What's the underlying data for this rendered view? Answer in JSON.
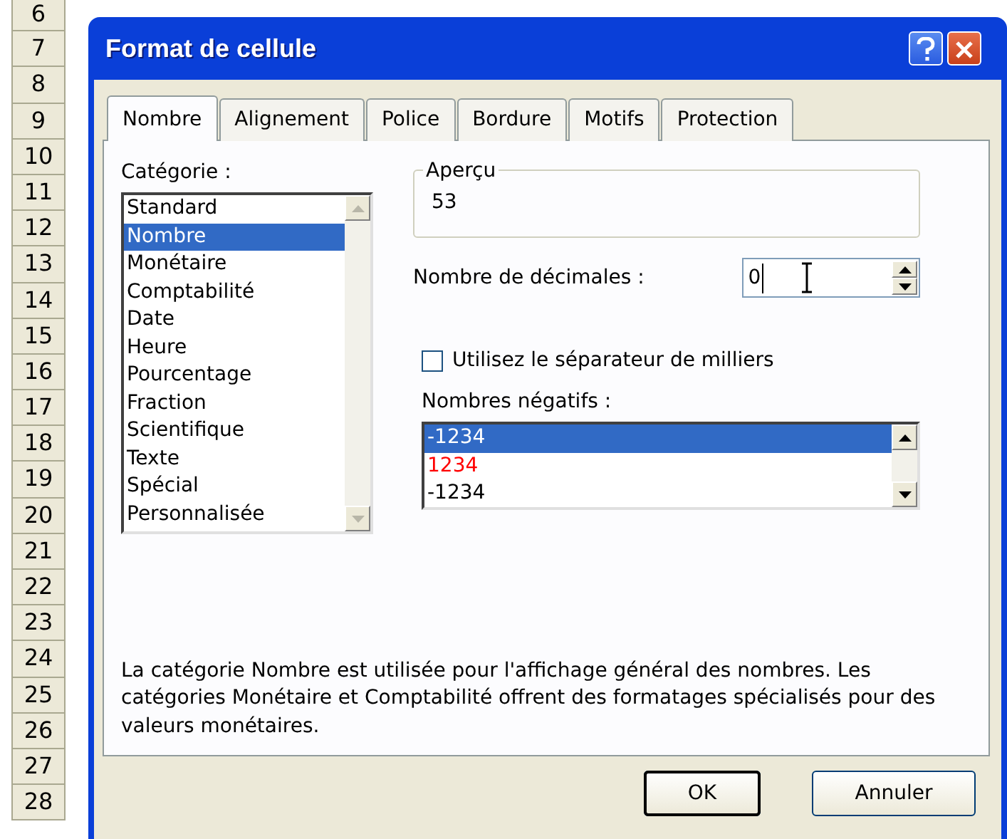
{
  "row_headers": [
    "6",
    "7",
    "8",
    "9",
    "10",
    "11",
    "12",
    "13",
    "14",
    "15",
    "16",
    "17",
    "18",
    "19",
    "20",
    "21",
    "22",
    "23",
    "24",
    "25",
    "26",
    "27",
    "28"
  ],
  "dialog": {
    "title": "Format de cellule",
    "tabs": [
      {
        "label": "Nombre",
        "selected": true
      },
      {
        "label": "Alignement",
        "selected": false
      },
      {
        "label": "Police",
        "selected": false
      },
      {
        "label": "Bordure",
        "selected": false
      },
      {
        "label": "Motifs",
        "selected": false
      },
      {
        "label": "Protection",
        "selected": false
      }
    ],
    "category": {
      "label": "Catégorie :",
      "items": [
        {
          "label": "Standard",
          "selected": false
        },
        {
          "label": "Nombre",
          "selected": true
        },
        {
          "label": "Monétaire",
          "selected": false
        },
        {
          "label": "Comptabilité",
          "selected": false
        },
        {
          "label": "Date",
          "selected": false
        },
        {
          "label": "Heure",
          "selected": false
        },
        {
          "label": "Pourcentage",
          "selected": false
        },
        {
          "label": "Fraction",
          "selected": false
        },
        {
          "label": "Scientifique",
          "selected": false
        },
        {
          "label": "Texte",
          "selected": false
        },
        {
          "label": "Spécial",
          "selected": false
        },
        {
          "label": "Personnalisée",
          "selected": false
        }
      ]
    },
    "preview": {
      "label": "Aperçu",
      "value": "53"
    },
    "decimals": {
      "label": "Nombre de décimales :",
      "value": "0"
    },
    "thousands_separator": {
      "label": "Utilisez le séparateur de milliers",
      "checked": false
    },
    "negative_numbers": {
      "label": "Nombres négatifs :",
      "items": [
        {
          "label": "-1234",
          "selected": true
        },
        {
          "label": "1234",
          "selected": false,
          "color": "#ff0000"
        },
        {
          "label": "-1234",
          "selected": false,
          "color": "#000000"
        }
      ]
    },
    "description": "La catégorie Nombre est utilisée pour l'affichage général des nombres. Les catégories Monétaire et Comptabilité offrent des formatages spécialisés pour des valeurs monétaires.",
    "buttons": [
      {
        "label": "OK",
        "default": true
      },
      {
        "label": "Annuler",
        "default": false
      }
    ]
  }
}
